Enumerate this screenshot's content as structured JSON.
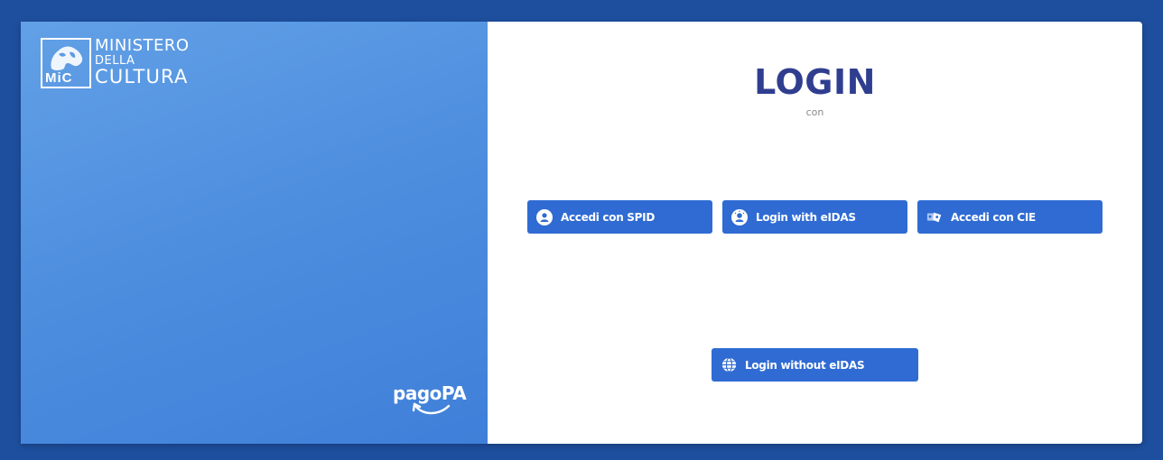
{
  "brand": {
    "mic_label": "MiC",
    "line1": "MINISTERO",
    "line2": "DELLA",
    "line3": "CULTURA",
    "logo_icon": "mic-emblem-icon"
  },
  "footer": {
    "pagopa_label": "pagoPA",
    "pagopa_icon": "pagopa-arrow-icon"
  },
  "login": {
    "title": "LOGIN",
    "subtitle": "con",
    "buttons": [
      {
        "label": "Accedi con SPID",
        "icon": "user-circle-icon"
      },
      {
        "label": "Login with eIDAS",
        "icon": "eidas-icon"
      },
      {
        "label": "Accedi con CIE",
        "icon": "cie-card-icon"
      },
      {
        "label": "Login without eIDAS",
        "icon": "globe-icon"
      }
    ]
  },
  "colors": {
    "background": "#1e4f9e",
    "panel_gradient_start": "#62a0e6",
    "panel_gradient_end": "#3f7fd9",
    "title": "#2f3e8f",
    "button": "#2f6bd3"
  }
}
